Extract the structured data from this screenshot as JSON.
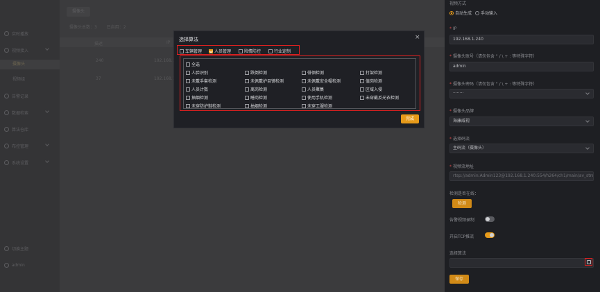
{
  "sidebar": {
    "items": [
      {
        "label": "实时播放",
        "top": 0
      },
      {
        "label": "视频接入"
      },
      {
        "label": "摄像头",
        "sub": true
      },
      {
        "label": "视频组",
        "sub": true
      },
      {
        "label": "告警记录"
      },
      {
        "label": "数据检索"
      },
      {
        "label": "算法仓库"
      },
      {
        "label": "布控管理"
      },
      {
        "label": "系统设置"
      }
    ],
    "bottom_items": [
      {
        "label": "切换主题"
      },
      {
        "label": "admin"
      }
    ]
  },
  "main": {
    "tab": "摄像头",
    "stats": {
      "total_label": "摄像头总数：",
      "total": "3",
      "enabled_label": "已启用：",
      "enabled": "2"
    },
    "columns": [
      "描述",
      "IP"
    ],
    "rows": [
      {
        "desc": "240",
        "ip": "192.168.1"
      },
      {
        "desc": "37",
        "ip": "192.168.1"
      }
    ]
  },
  "panel": {
    "source_label": "视频方式",
    "radio_auto": "自动生成",
    "radio_manual": "手动输入",
    "ip_label": "IP",
    "ip_value": "192.168.1.240",
    "account_label": "摄像头账号（请勿包含 \" / \\ + : 等特殊字符）",
    "account_value": "admin",
    "password_label": "摄像头密码（请勿包含 \" / \\ + : 等特殊字符）",
    "password_value": "········",
    "brand_label": "摄像头品牌",
    "brand_value": "海康威视",
    "stream_label": "选择码流",
    "stream_value": "主码流（摄像头）",
    "url_label": "视频流地址",
    "url_value": "rtsp://admin:Admin123@192.168.1.240:554/h264/ch1/main/av_stream",
    "online_label": "检测是否在线：",
    "detect_button": "检测",
    "alarm_record_label": "告警视频录制",
    "tcp_label": "开启TCP推流",
    "algo_label": "选择算法",
    "save_button": "保存"
  },
  "modal": {
    "title": "选择算法",
    "categories": [
      {
        "label": "车辆管理",
        "checked": false
      },
      {
        "label": "人员管理",
        "checked": true
      },
      {
        "label": "险情防控",
        "checked": false
      },
      {
        "label": "行业定制",
        "checked": false
      }
    ],
    "select_all": "全选",
    "algorithms": [
      [
        "人脸识别",
        "跌倒检测",
        "徘徊检测",
        "打架检测"
      ],
      [
        "未戴手套检测",
        "未佩戴护目镜检测",
        "未佩戴安全帽检测",
        "值岗检测"
      ],
      [
        "人员计数",
        "离岗检测",
        "人员聚集",
        "区域入侵"
      ],
      [
        "抽烟检测",
        "睡岗检测",
        "使用手机检测",
        "未穿戴反光衣检测"
      ],
      [
        "未穿防护鞋检测",
        "抽烟检测",
        "未穿工服检测"
      ]
    ],
    "done_button": "完成"
  }
}
